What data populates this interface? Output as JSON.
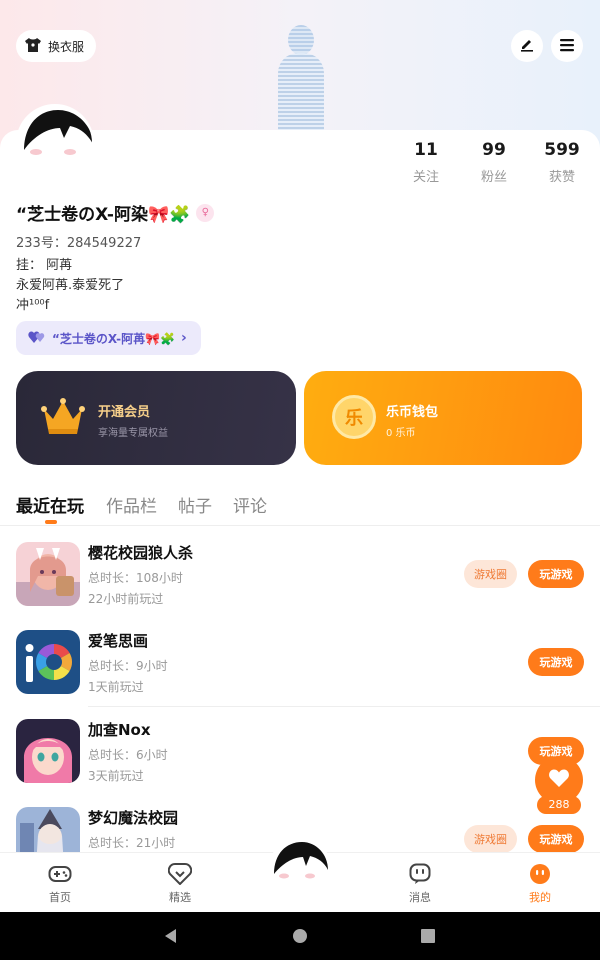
{
  "header": {
    "change_outfit_label": "换衣服"
  },
  "profile": {
    "stats": [
      {
        "value": "11",
        "label": "关注"
      },
      {
        "value": "99",
        "label": "粉丝"
      },
      {
        "value": "599",
        "label": "获赞"
      }
    ],
    "nickname": "“芝士卷のX-阿染🎀🧩",
    "uid": "233号：284549227",
    "bio_lines": [
      "挂：  阿苒",
      "永爱阿苒.泰爱死了",
      "冲¹⁰⁰f"
    ],
    "linked_tag": "“芝士卷のX-阿苒🎀🧩"
  },
  "cards": {
    "vip": {
      "title": "开通会员",
      "subtitle": "享海量专属权益"
    },
    "wallet": {
      "title": "乐币钱包",
      "subtitle": "0 乐币",
      "coin_glyph": "乐"
    }
  },
  "tabs": [
    "最近在玩",
    "作品栏",
    "帖子",
    "评论"
  ],
  "games": [
    {
      "name": "樱花校园狼人杀",
      "total_time": "总时长：108小时",
      "last_played": "22小时前玩过",
      "circle_label": "游戏圈",
      "play_label": "玩游戏"
    },
    {
      "name": "爱笔思画",
      "total_time": "总时长：9小时",
      "last_played": "1天前玩过",
      "circle_label": "",
      "play_label": "玩游戏"
    },
    {
      "name": "加查Nox",
      "total_time": "总时长：6小时",
      "last_played": "3天前玩过",
      "circle_label": "",
      "play_label": "玩游戏"
    },
    {
      "name": "梦幻魔法校园",
      "total_time": "总时长：21小时",
      "last_played": "",
      "circle_label": "游戏圈",
      "play_label": "玩游戏"
    }
  ],
  "like": {
    "count": "288"
  },
  "nav": {
    "home": "首页",
    "featured": "精选",
    "messages": "消息",
    "mine": "我的"
  },
  "colors": {
    "accent": "#ff7b1a",
    "vip_gold": "#f6cf8a",
    "tag_purple": "#5b55c8"
  }
}
